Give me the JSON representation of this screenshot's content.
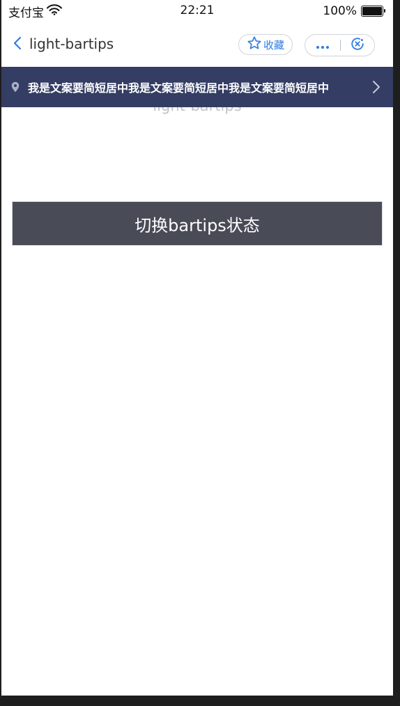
{
  "status_bar": {
    "carrier": "支付宝",
    "time": "22:21",
    "battery": "100%",
    "battery_level": 1.0
  },
  "nav": {
    "back_icon": "chevron-left-icon",
    "title": "light-bartips",
    "favorite_label": "收藏",
    "favorite_icon": "star-outline-icon",
    "more_icon": "ellipsis-icon",
    "close_icon": "target-close-icon"
  },
  "tips": {
    "icon": "location-pin-icon",
    "text": "我是文案要简短居中我是文案要简短居中我是文案要简短居中",
    "arrow_icon": "chevron-right-icon",
    "background": "#343d63"
  },
  "page": {
    "heading": "light-bartips",
    "toggle_button_label": "切换bartips状态"
  },
  "colors": {
    "accent": "#2f7be0",
    "button_bg": "#494b57"
  }
}
